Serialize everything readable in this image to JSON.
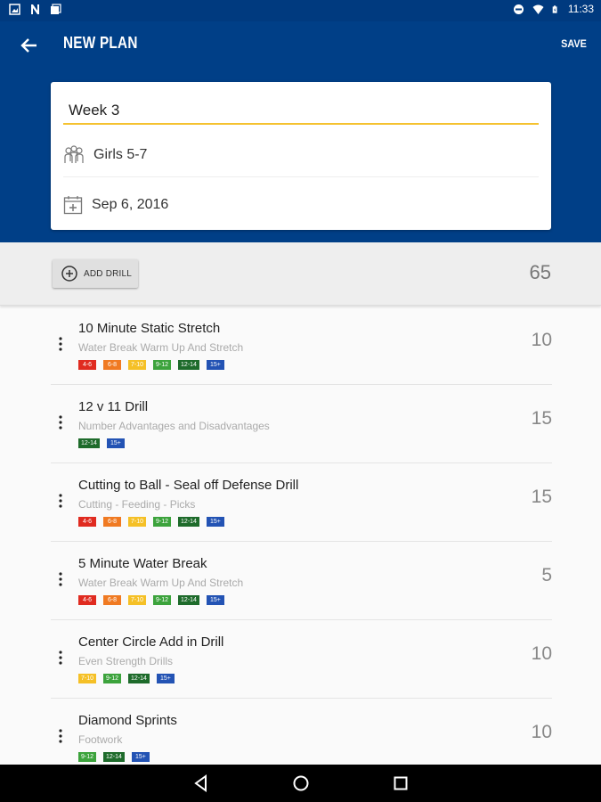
{
  "status": {
    "time": "11:33"
  },
  "appbar": {
    "title": "NEW PLAN",
    "save_label": "SAVE"
  },
  "plan": {
    "name": "Week 3",
    "team": "Girls 5-7",
    "date": "Sep 6, 2016"
  },
  "add_drill": {
    "label": "ADD DRILL",
    "total_minutes": "65"
  },
  "tag_colors": {
    "4-6": "#e02b20",
    "6-8": "#f07a22",
    "7-10": "#f5c026",
    "9-12": "#3ca33c",
    "12-14": "#1e6b2b",
    "15+": "#2353b4"
  },
  "drills": [
    {
      "name": "10 Minute Static Stretch",
      "desc": "Water Break Warm Up And Stretch",
      "minutes": "10",
      "tags": [
        "4-6",
        "6-8",
        "7-10",
        "9-12",
        "12-14",
        "15+"
      ]
    },
    {
      "name": "12 v 11 Drill",
      "desc": "Number Advantages and Disadvantages",
      "minutes": "15",
      "tags": [
        "12-14",
        "15+"
      ]
    },
    {
      "name": "Cutting to Ball - Seal off Defense Drill",
      "desc": "Cutting - Feeding - Picks",
      "minutes": "15",
      "tags": [
        "4-6",
        "6-8",
        "7-10",
        "9-12",
        "12-14",
        "15+"
      ]
    },
    {
      "name": "5 Minute Water Break",
      "desc": "Water Break Warm Up And Stretch",
      "minutes": "5",
      "tags": [
        "4-6",
        "6-8",
        "7-10",
        "9-12",
        "12-14",
        "15+"
      ]
    },
    {
      "name": "Center Circle Add in Drill",
      "desc": "Even Strength Drills",
      "minutes": "10",
      "tags": [
        "7-10",
        "9-12",
        "12-14",
        "15+"
      ]
    },
    {
      "name": "Diamond Sprints",
      "desc": "Footwork",
      "minutes": "10",
      "tags": [
        "9-12",
        "12-14",
        "15+"
      ]
    }
  ]
}
